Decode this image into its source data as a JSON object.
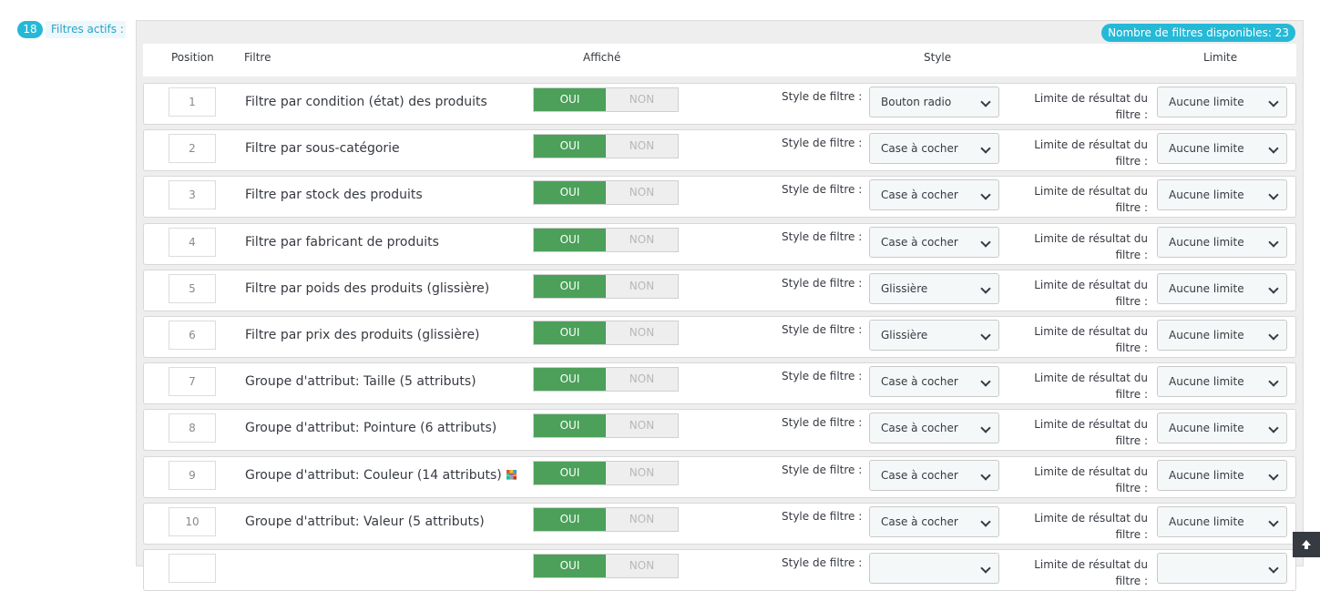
{
  "active_filters": {
    "count": "18",
    "label": "Filtres actifs :"
  },
  "available_filters_badge": "Nombre de filtres disponibles: 23",
  "table_headers": {
    "position": "Position",
    "filter": "Filtre",
    "displayed": "Affiché",
    "style": "Style",
    "limit": "Limite"
  },
  "labels": {
    "yes": "OUI",
    "no": "NON",
    "style_label": "Style de filtre :",
    "limit_label": "Limite de résultat du filtre :"
  },
  "rows": [
    {
      "position": "1",
      "name": "Filtre par condition (état) des produits",
      "style": "Bouton radio",
      "limit": "Aucune limite",
      "color_icon": false
    },
    {
      "position": "2",
      "name": "Filtre par sous-catégorie",
      "style": "Case à cocher",
      "limit": "Aucune limite",
      "color_icon": false
    },
    {
      "position": "3",
      "name": "Filtre par stock des produits",
      "style": "Case à cocher",
      "limit": "Aucune limite",
      "color_icon": false
    },
    {
      "position": "4",
      "name": "Filtre par fabricant de produits",
      "style": "Case à cocher",
      "limit": "Aucune limite",
      "color_icon": false
    },
    {
      "position": "5",
      "name": "Filtre par poids des produits (glissière)",
      "style": "Glissière",
      "limit": "Aucune limite",
      "color_icon": false
    },
    {
      "position": "6",
      "name": "Filtre par prix des produits (glissière)",
      "style": "Glissière",
      "limit": "Aucune limite",
      "color_icon": false
    },
    {
      "position": "7",
      "name": "Groupe d'attribut: Taille (5 attributs)",
      "style": "Case à cocher",
      "limit": "Aucune limite",
      "color_icon": false
    },
    {
      "position": "8",
      "name": "Groupe d'attribut: Pointure (6 attributs)",
      "style": "Case à cocher",
      "limit": "Aucune limite",
      "color_icon": false
    },
    {
      "position": "9",
      "name": "Groupe d'attribut: Couleur (14 attributs)",
      "style": "Case à cocher",
      "limit": "Aucune limite",
      "color_icon": true
    },
    {
      "position": "10",
      "name": "Groupe d'attribut: Valeur (5 attributs)",
      "style": "Case à cocher",
      "limit": "Aucune limite",
      "color_icon": false
    },
    {
      "position": "",
      "name": "",
      "style": "",
      "limit": "",
      "color_icon": false
    }
  ],
  "icons": {
    "color": "color-palette-icon",
    "chevron": "chevron-down-icon",
    "scroll_top": "arrow-up-icon"
  },
  "colors": {
    "accent": "#25b9d7",
    "yes_active": "#4ca05a",
    "scroll_button": "#363a41"
  }
}
